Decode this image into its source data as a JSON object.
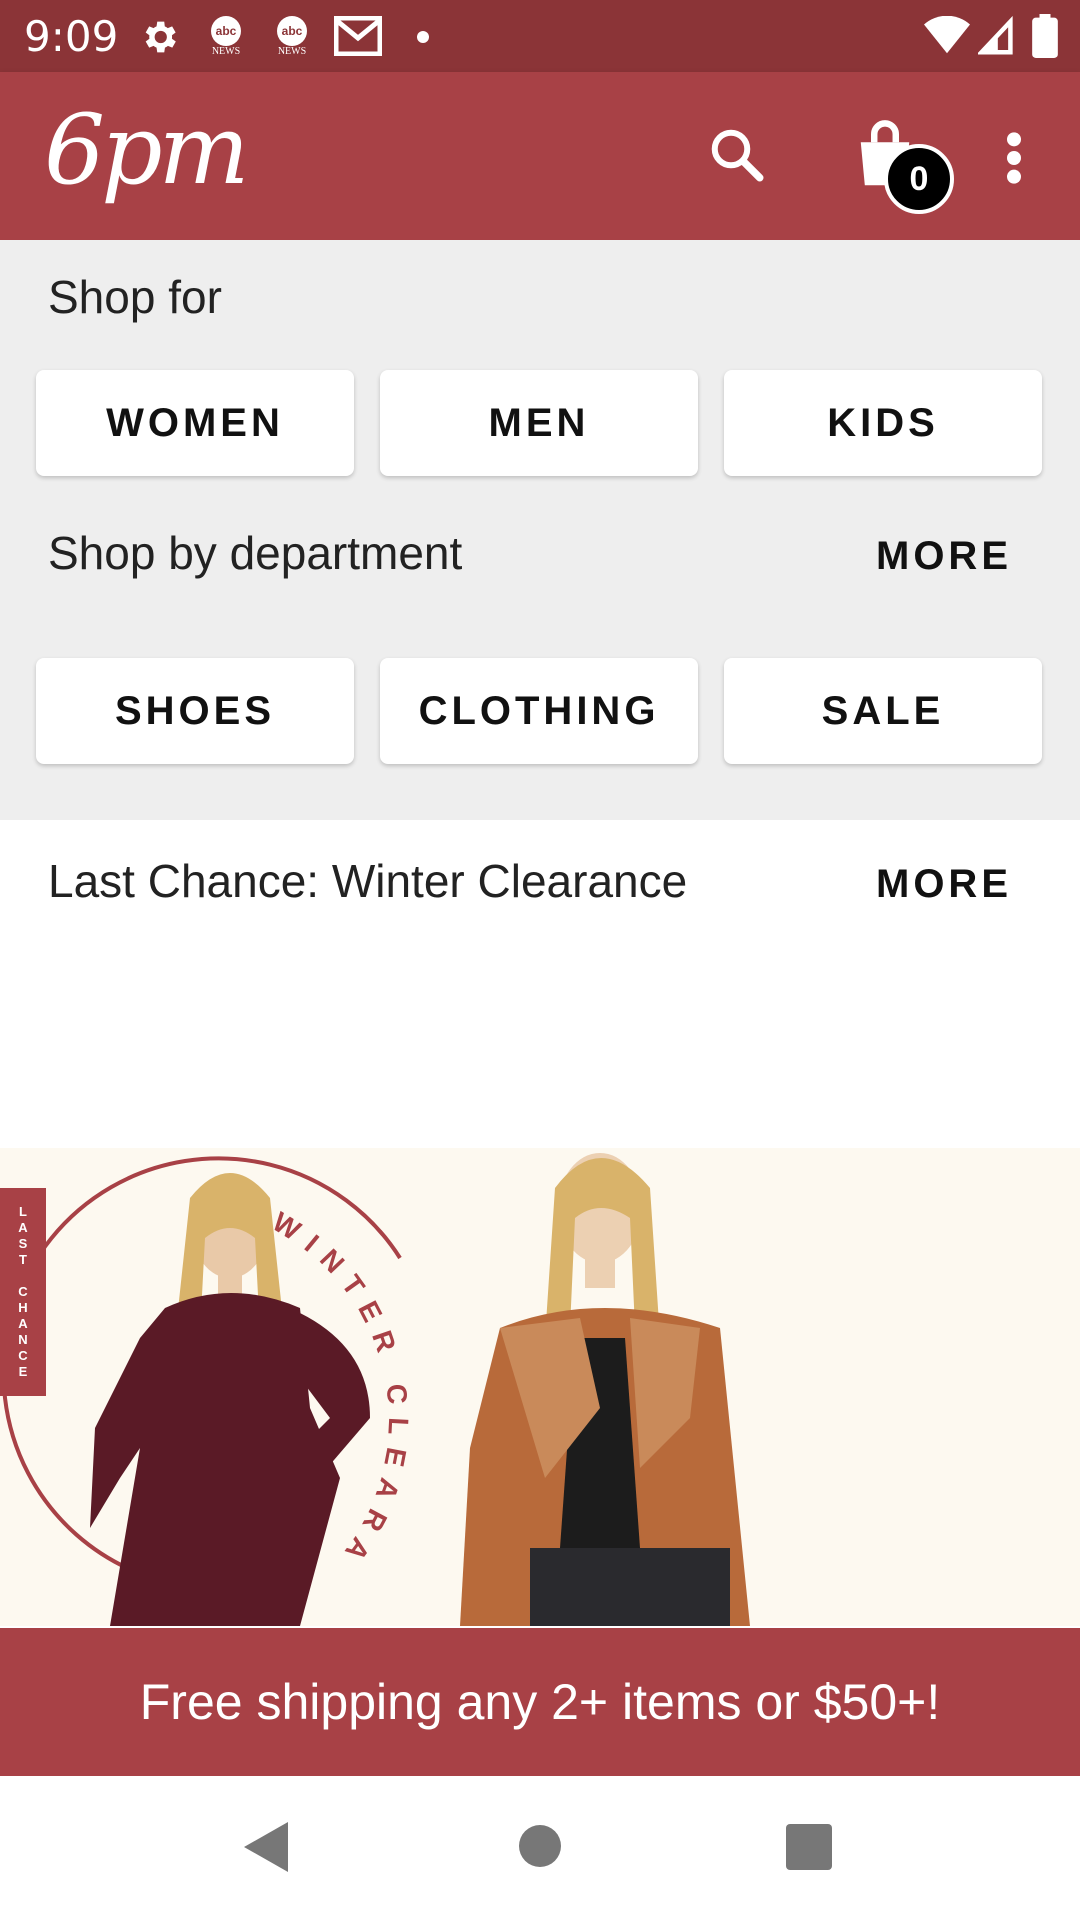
{
  "status_bar": {
    "time": "9:09",
    "icons": [
      "gear-icon",
      "abc-news-icon",
      "abc-news-icon",
      "gmail-icon",
      "dot-icon",
      "wifi-icon",
      "signal-icon",
      "battery-icon"
    ],
    "abc_label": "NEWS"
  },
  "app_bar": {
    "logo": "6pm",
    "cart_count": "0",
    "icons": [
      "search-icon",
      "shopping-bag-icon",
      "more-vert-icon"
    ]
  },
  "shop_for": {
    "title": "Shop for",
    "options": [
      "WOMEN",
      "MEN",
      "KIDS"
    ]
  },
  "departments": {
    "title": "Shop by department",
    "more_label": "MORE",
    "options": [
      "SHOES",
      "CLOTHING",
      "SALE"
    ]
  },
  "clearance": {
    "title": "Last Chance: Winter Clearance",
    "more_label": "MORE",
    "banner_tag": "LAST CHANCE",
    "banner_circle_text": "WINTER CLEARANCE"
  },
  "promo": {
    "text": "Free shipping any 2+ items or $50+!"
  },
  "colors": {
    "status_bar": "#8b3437",
    "brand": "#a84146",
    "panel": "#eeeeee",
    "banner_bg": "#fdf9f0",
    "dress": "#5a1a26",
    "jacket": "#b86a3a"
  },
  "nav": {
    "icons": [
      "back-icon",
      "home-icon",
      "recents-icon"
    ]
  }
}
